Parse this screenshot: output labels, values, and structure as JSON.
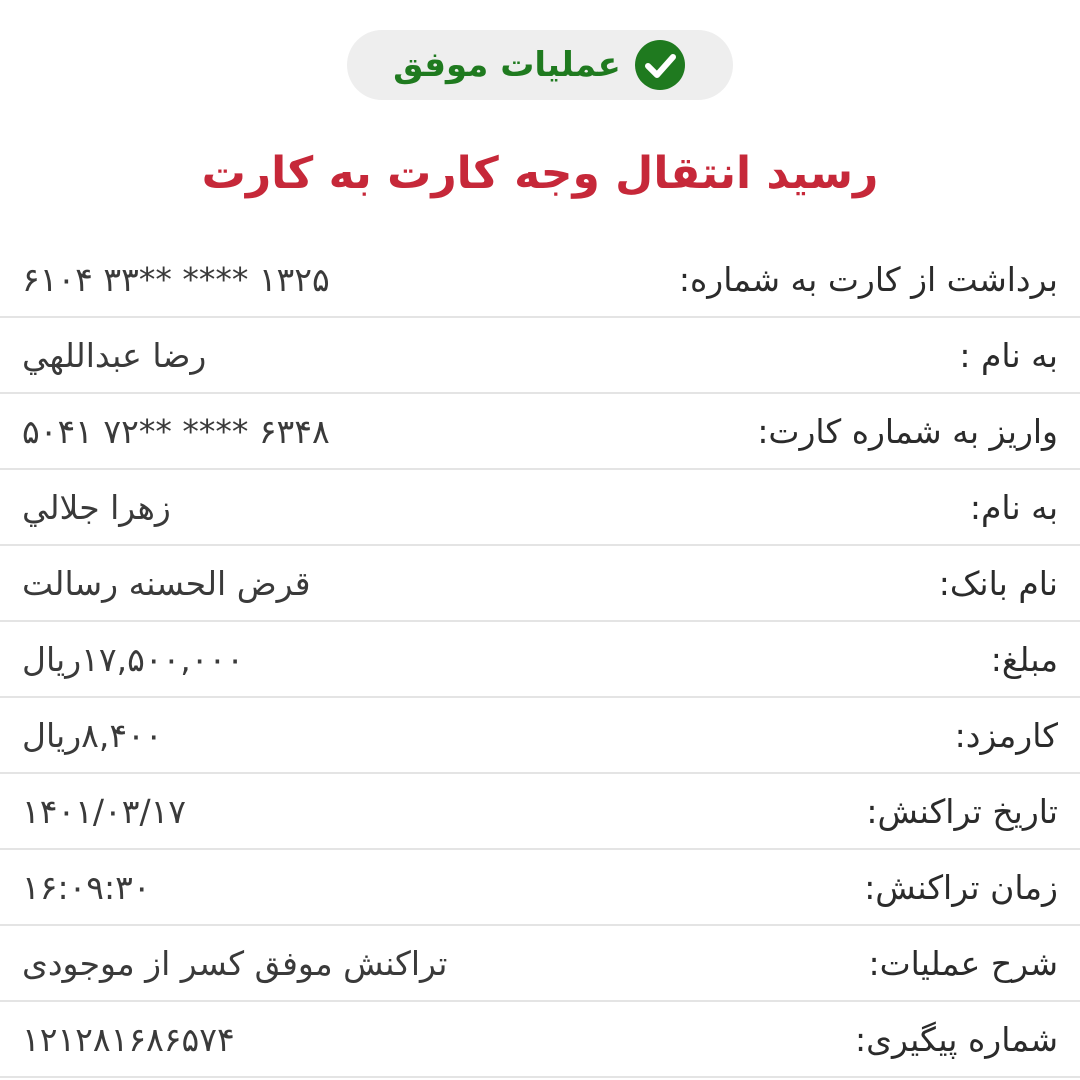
{
  "header": {
    "status_text": "عملیات موفق",
    "status_icon": "check-circle-icon",
    "status_color": "#1f7a1f",
    "title": "رسید انتقال وجه کارت به کارت",
    "title_color": "#c62839"
  },
  "receipt": {
    "rows": [
      {
        "label": "برداشت از کارت به شماره:",
        "value": "۶۱۰۴ ۳۳** **** ۱۳۲۵"
      },
      {
        "label": "به نام :",
        "value": "رضا عبداللهي"
      },
      {
        "label": "واریز به شماره کارت:",
        "value": "۵۰۴۱ ۷۲** **** ۶۳۴۸"
      },
      {
        "label": "به نام:",
        "value": "زهرا جلالي"
      },
      {
        "label": "نام بانک:",
        "value": "قرض الحسنه رسالت"
      },
      {
        "label": "مبلغ:",
        "value": "۱۷,۵۰۰,۰۰۰ریال"
      },
      {
        "label": "کارمزد:",
        "value": "۸,۴۰۰ریال"
      },
      {
        "label": "تاریخ تراکنش:",
        "value": "۱۴۰۱/۰۳/۱۷"
      },
      {
        "label": "زمان تراکنش:",
        "value": "۱۶:۰۹:۳۰"
      },
      {
        "label": "شرح عملیات:",
        "value": "تراکنش موفق کسر از موجودی"
      },
      {
        "label": "شماره پیگیری:",
        "value": "۱۲۱۲۸۱۶۸۶۵۷۴"
      }
    ]
  }
}
